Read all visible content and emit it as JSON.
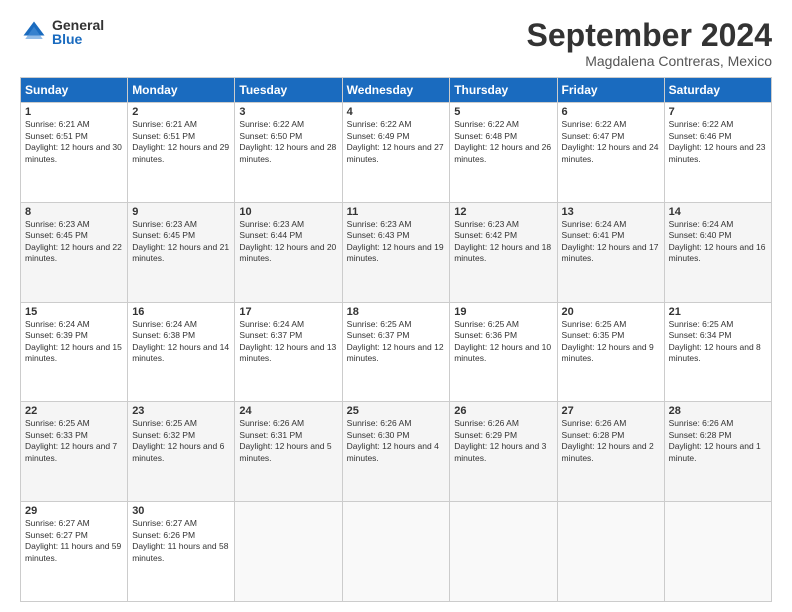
{
  "logo": {
    "general": "General",
    "blue": "Blue"
  },
  "title": "September 2024",
  "location": "Magdalena Contreras, Mexico",
  "headers": [
    "Sunday",
    "Monday",
    "Tuesday",
    "Wednesday",
    "Thursday",
    "Friday",
    "Saturday"
  ],
  "weeks": [
    [
      {
        "day": "1",
        "sunrise": "6:21 AM",
        "sunset": "6:51 PM",
        "daylight": "12 hours and 30 minutes."
      },
      {
        "day": "2",
        "sunrise": "6:21 AM",
        "sunset": "6:51 PM",
        "daylight": "12 hours and 29 minutes."
      },
      {
        "day": "3",
        "sunrise": "6:22 AM",
        "sunset": "6:50 PM",
        "daylight": "12 hours and 28 minutes."
      },
      {
        "day": "4",
        "sunrise": "6:22 AM",
        "sunset": "6:49 PM",
        "daylight": "12 hours and 27 minutes."
      },
      {
        "day": "5",
        "sunrise": "6:22 AM",
        "sunset": "6:48 PM",
        "daylight": "12 hours and 26 minutes."
      },
      {
        "day": "6",
        "sunrise": "6:22 AM",
        "sunset": "6:47 PM",
        "daylight": "12 hours and 24 minutes."
      },
      {
        "day": "7",
        "sunrise": "6:22 AM",
        "sunset": "6:46 PM",
        "daylight": "12 hours and 23 minutes."
      }
    ],
    [
      {
        "day": "8",
        "sunrise": "6:23 AM",
        "sunset": "6:45 PM",
        "daylight": "12 hours and 22 minutes."
      },
      {
        "day": "9",
        "sunrise": "6:23 AM",
        "sunset": "6:45 PM",
        "daylight": "12 hours and 21 minutes."
      },
      {
        "day": "10",
        "sunrise": "6:23 AM",
        "sunset": "6:44 PM",
        "daylight": "12 hours and 20 minutes."
      },
      {
        "day": "11",
        "sunrise": "6:23 AM",
        "sunset": "6:43 PM",
        "daylight": "12 hours and 19 minutes."
      },
      {
        "day": "12",
        "sunrise": "6:23 AM",
        "sunset": "6:42 PM",
        "daylight": "12 hours and 18 minutes."
      },
      {
        "day": "13",
        "sunrise": "6:24 AM",
        "sunset": "6:41 PM",
        "daylight": "12 hours and 17 minutes."
      },
      {
        "day": "14",
        "sunrise": "6:24 AM",
        "sunset": "6:40 PM",
        "daylight": "12 hours and 16 minutes."
      }
    ],
    [
      {
        "day": "15",
        "sunrise": "6:24 AM",
        "sunset": "6:39 PM",
        "daylight": "12 hours and 15 minutes."
      },
      {
        "day": "16",
        "sunrise": "6:24 AM",
        "sunset": "6:38 PM",
        "daylight": "12 hours and 14 minutes."
      },
      {
        "day": "17",
        "sunrise": "6:24 AM",
        "sunset": "6:37 PM",
        "daylight": "12 hours and 13 minutes."
      },
      {
        "day": "18",
        "sunrise": "6:25 AM",
        "sunset": "6:37 PM",
        "daylight": "12 hours and 12 minutes."
      },
      {
        "day": "19",
        "sunrise": "6:25 AM",
        "sunset": "6:36 PM",
        "daylight": "12 hours and 10 minutes."
      },
      {
        "day": "20",
        "sunrise": "6:25 AM",
        "sunset": "6:35 PM",
        "daylight": "12 hours and 9 minutes."
      },
      {
        "day": "21",
        "sunrise": "6:25 AM",
        "sunset": "6:34 PM",
        "daylight": "12 hours and 8 minutes."
      }
    ],
    [
      {
        "day": "22",
        "sunrise": "6:25 AM",
        "sunset": "6:33 PM",
        "daylight": "12 hours and 7 minutes."
      },
      {
        "day": "23",
        "sunrise": "6:25 AM",
        "sunset": "6:32 PM",
        "daylight": "12 hours and 6 minutes."
      },
      {
        "day": "24",
        "sunrise": "6:26 AM",
        "sunset": "6:31 PM",
        "daylight": "12 hours and 5 minutes."
      },
      {
        "day": "25",
        "sunrise": "6:26 AM",
        "sunset": "6:30 PM",
        "daylight": "12 hours and 4 minutes."
      },
      {
        "day": "26",
        "sunrise": "6:26 AM",
        "sunset": "6:29 PM",
        "daylight": "12 hours and 3 minutes."
      },
      {
        "day": "27",
        "sunrise": "6:26 AM",
        "sunset": "6:28 PM",
        "daylight": "12 hours and 2 minutes."
      },
      {
        "day": "28",
        "sunrise": "6:26 AM",
        "sunset": "6:28 PM",
        "daylight": "12 hours and 1 minute."
      }
    ],
    [
      {
        "day": "29",
        "sunrise": "6:27 AM",
        "sunset": "6:27 PM",
        "daylight": "11 hours and 59 minutes."
      },
      {
        "day": "30",
        "sunrise": "6:27 AM",
        "sunset": "6:26 PM",
        "daylight": "11 hours and 58 minutes."
      },
      null,
      null,
      null,
      null,
      null
    ]
  ]
}
